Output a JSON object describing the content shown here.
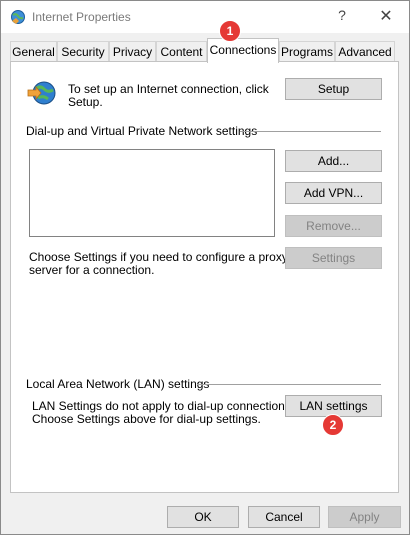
{
  "window": {
    "title": "Internet Properties",
    "help_glyph": "?",
    "close_glyph": "✕"
  },
  "tabs": [
    {
      "label": "General"
    },
    {
      "label": "Security"
    },
    {
      "label": "Privacy"
    },
    {
      "label": "Content"
    },
    {
      "label": "Connections",
      "active": true
    },
    {
      "label": "Programs"
    },
    {
      "label": "Advanced"
    }
  ],
  "setup": {
    "text_line1": "To set up an Internet connection, click",
    "text_line2": "Setup.",
    "button": "Setup"
  },
  "dialup": {
    "heading": "Dial-up and Virtual Private Network settings",
    "add_button": "Add...",
    "add_vpn_button": "Add VPN...",
    "remove_button": "Remove...",
    "settings_button": "Settings",
    "proxy_line1": "Choose Settings if you need to configure a proxy",
    "proxy_line2": "server for a connection."
  },
  "lan": {
    "heading": "Local Area Network (LAN) settings",
    "note_line1": "LAN Settings do not apply to dial-up connections.",
    "note_line2": "Choose Settings above for dial-up settings.",
    "button": "LAN settings"
  },
  "footer": {
    "ok": "OK",
    "cancel": "Cancel",
    "apply": "Apply"
  },
  "badges": {
    "one": "1",
    "two": "2"
  },
  "colors": {
    "badge": "#e53935",
    "button_bg": "#e1e1e1",
    "disabled_text": "#838383"
  },
  "icons": {
    "title": "internet-globe-icon",
    "setup": "globe-connect-icon"
  }
}
